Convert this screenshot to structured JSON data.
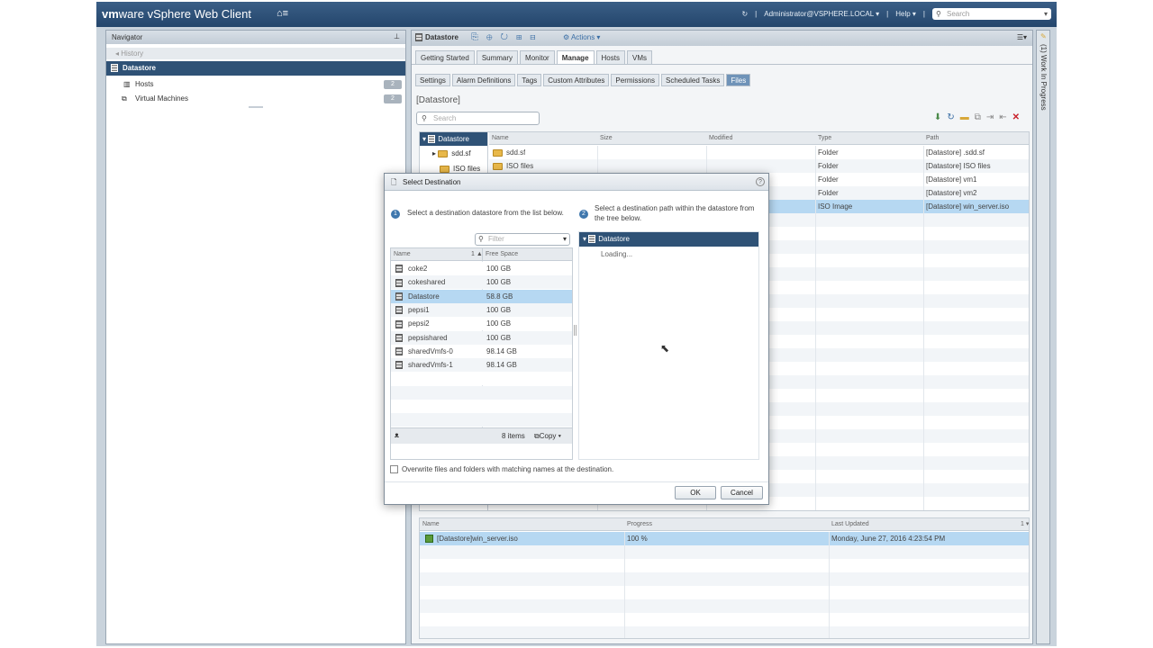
{
  "header": {
    "logo_brand": "vm",
    "logo_rest": "ware",
    "app_title": "vSphere Web Client",
    "user": "Administrator@VSPHERE.LOCAL",
    "help": "Help",
    "search_placeholder": "Search"
  },
  "navigator": {
    "title": "Navigator",
    "history": "History",
    "selected": "Datastore",
    "items": [
      {
        "label": "Hosts",
        "count": "2"
      },
      {
        "label": "Virtual Machines",
        "count": "2"
      }
    ]
  },
  "main": {
    "object": "Datastore",
    "actions": "Actions",
    "tabs": [
      "Getting Started",
      "Summary",
      "Monitor",
      "Manage",
      "Hosts",
      "VMs"
    ],
    "active_tab": "Manage",
    "subtabs": [
      "Settings",
      "Alarm Definitions",
      "Tags",
      "Custom Attributes",
      "Permissions",
      "Scheduled Tasks",
      "Files"
    ],
    "active_subtab": "Files",
    "breadcrumb": "[Datastore]",
    "search_placeholder": "Search",
    "tree": {
      "root": "Datastore",
      "children": [
        "sdd.sf",
        "ISO files"
      ]
    },
    "file_columns": [
      "Name",
      "Size",
      "Modified",
      "Type",
      "Path"
    ],
    "files": [
      {
        "name": "sdd.sf",
        "type": "Folder",
        "path": "[Datastore] .sdd.sf"
      },
      {
        "name": "ISO files",
        "type": "Folder",
        "path": "[Datastore] ISO files"
      },
      {
        "name": "",
        "type": "Folder",
        "path": "[Datastore] vm1"
      },
      {
        "name": "",
        "type": "Folder",
        "path": "[Datastore] vm2"
      },
      {
        "name": "",
        "type": "ISO Image",
        "path": "[Datastore] win_server.iso"
      }
    ],
    "tasks_columns": [
      "Name",
      "Progress",
      "Last Updated"
    ],
    "tasks_sort": "1 ▾",
    "tasks": [
      {
        "name": "[Datastore]win_server.iso",
        "progress": "100 %",
        "updated": "Monday, June 27, 2016 4:23:54 PM"
      }
    ]
  },
  "wip": {
    "label": "(1) Work In Progress"
  },
  "dialog": {
    "title": "Select Destination",
    "step1_num": "1",
    "step1_text": "Select a destination datastore from the list below.",
    "step2_num": "2",
    "step2_text": "Select a destination path within the datastore from the tree below.",
    "filter_placeholder": "Filter",
    "col_name": "Name",
    "col_sort": "1 ▲",
    "col_free": "Free Space",
    "datastores": [
      {
        "name": "coke2",
        "free": "100  GB"
      },
      {
        "name": "cokeshared",
        "free": "100  GB"
      },
      {
        "name": "Datastore",
        "free": "58.8  GB"
      },
      {
        "name": "pepsi1",
        "free": "100  GB"
      },
      {
        "name": "pepsi2",
        "free": "100  GB"
      },
      {
        "name": "pepsishared",
        "free": "100  GB"
      },
      {
        "name": "sharedVmfs-0",
        "free": "98.14  GB"
      },
      {
        "name": "sharedVmfs-1",
        "free": "98.14  GB"
      }
    ],
    "item_count": "8 items",
    "copy_label": "Copy",
    "tree_root": "Datastore",
    "loading": "Loading...",
    "overwrite_label": "Overwrite files and folders with matching names at the destination.",
    "ok": "OK",
    "cancel": "Cancel"
  },
  "colors": {
    "header_blue": "#2f5276",
    "selection": "#b6d8f2",
    "accent": "#3f77ad"
  }
}
